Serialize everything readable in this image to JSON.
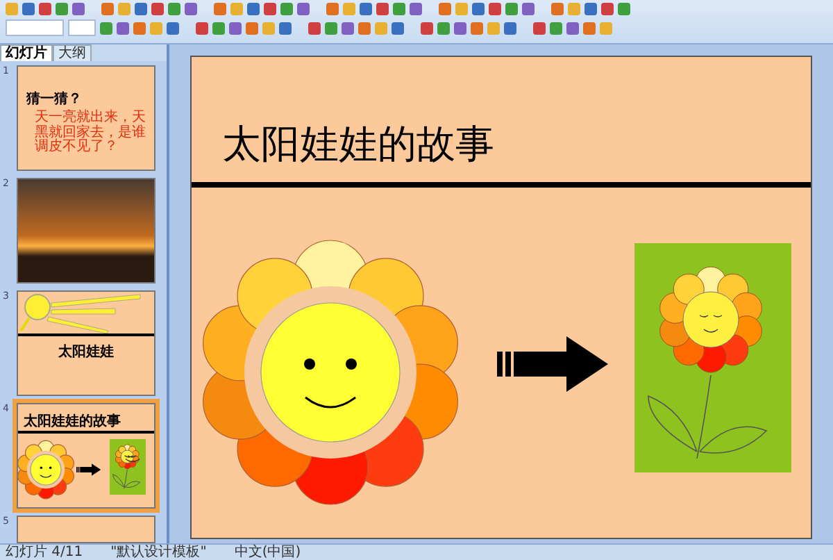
{
  "tabs": [
    {
      "label": "幻灯片",
      "selected": true
    },
    {
      "label": "大纲",
      "selected": false
    }
  ],
  "slides": [
    {
      "kind": "question",
      "number": "1",
      "selected": false,
      "title": "猜一猜？",
      "body": "天一亮就出来，天黑就回家去，是谁调皮不见了？"
    },
    {
      "kind": "photo",
      "number": "2",
      "selected": false
    },
    {
      "kind": "sun",
      "number": "3",
      "selected": false,
      "title": "太阳娃娃"
    },
    {
      "kind": "story",
      "number": "4",
      "selected": true,
      "title": "太阳娃娃的故事"
    },
    {
      "kind": "blank",
      "number": "5",
      "selected": false
    }
  ],
  "main_slide": {
    "title": "太阳娃娃的故事"
  },
  "status_bar": [
    "幻灯片 4/11",
    "\"默认设计模板\"",
    "中文(中国)"
  ]
}
